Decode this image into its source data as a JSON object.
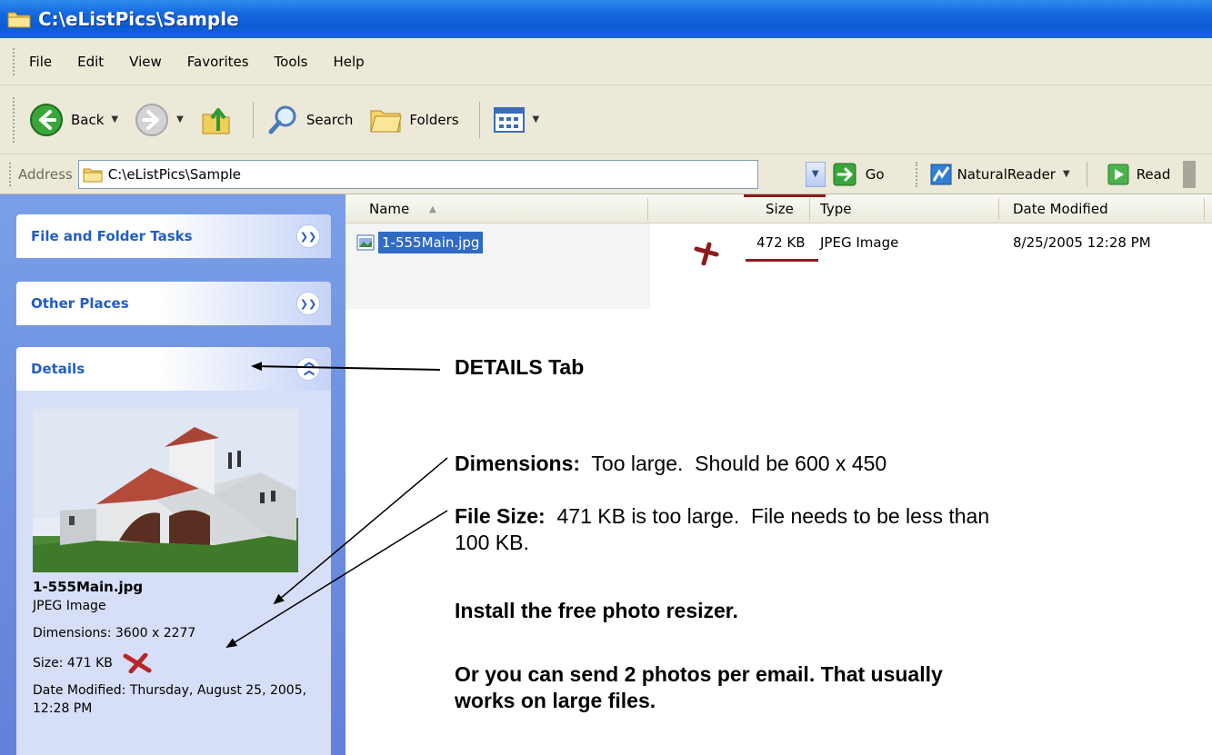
{
  "window": {
    "title": "C:\\eListPics\\Sample"
  },
  "menu": {
    "items": [
      "File",
      "Edit",
      "View",
      "Favorites",
      "Tools",
      "Help"
    ]
  },
  "toolbar": {
    "back_label": "Back",
    "search_label": "Search",
    "folders_label": "Folders"
  },
  "address": {
    "label": "Address",
    "path": "C:\\eListPics\\Sample",
    "go_label": "Go",
    "naturalreader_label": "NaturalReader",
    "read_label": "Read"
  },
  "taskpane": {
    "file_folder_tasks": "File and Folder Tasks",
    "other_places": "Other Places",
    "details": "Details",
    "detail_name": "1-555Main.jpg",
    "detail_type": "JPEG Image",
    "detail_dimensions": "Dimensions: 3600 x 2277",
    "detail_size": "Size: 471 KB",
    "detail_date": "Date Modified: Thursday, August 25, 2005, 12:28 PM"
  },
  "columns": {
    "name": "Name",
    "size": "Size",
    "type": "Type",
    "date_modified": "Date Modified"
  },
  "files": [
    {
      "name": "1-555Main.jpg",
      "size": "472 KB",
      "type": "JPEG Image",
      "date_modified": "8/25/2005 12:28 PM"
    }
  ],
  "annotations": {
    "details_tab": "DETAILS  Tab",
    "dimensions_label": "Dimensions:",
    "dimensions_text": "  Too large.  Should be 600 x 450",
    "filesize_label": "File Size:",
    "filesize_text_1": "  471 KB is too large.  File needs to be less than",
    "filesize_text_2": "100 KB.",
    "install": "Install the free photo resizer.",
    "email_1": "Or you can send 2 photos per email. That usually",
    "email_2": "works on large files."
  },
  "colors": {
    "title_blue": "#0b5ad6",
    "taskpane_blue": "#6d8fe0",
    "header_text": "#215dc6",
    "selection": "#316ac5",
    "mark_red": "#8b1c1c"
  }
}
